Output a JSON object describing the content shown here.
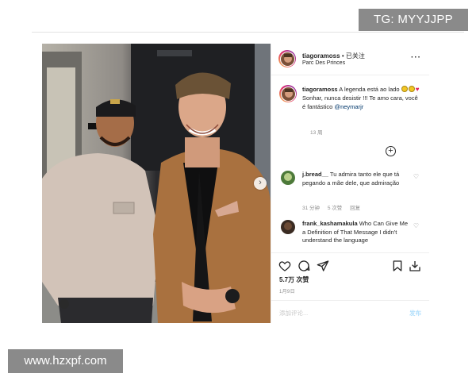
{
  "watermarks": {
    "top": "TG: MYYJJPP",
    "bottom": "www.hzxpf.com"
  },
  "post": {
    "header": {
      "username": "tiagoramoss",
      "follow": "• 已关注",
      "location": "Parc Des Princes"
    },
    "caption": {
      "username": "tiagoramoss",
      "text_start": "A legenda está ao lado",
      "text_end": "Sonhar, nunca desistir !!! Te amo cara, você é fantástico",
      "mention": "@neymarjr",
      "time": "13 周",
      "emojis": [
        "grinning-sweat-emoji",
        "grinning-sweat-emoji",
        "red-heart-emoji"
      ]
    },
    "comments": [
      {
        "username": "j.bread__",
        "text": "Tu admira tanto ele que tá pegando a mãe dele, que admiração",
        "time": "31 分钟",
        "likes": "5 次赞",
        "reply": "回复"
      },
      {
        "username": "frank_kashamakula",
        "text": "Who Can Give Me a Definition of That Message I didn't understand the language"
      }
    ],
    "likes_count": "5.7万 次赞",
    "date": "1月9日",
    "add_comment_placeholder": "添加评论...",
    "post_button": "发布",
    "colors": {
      "link": "#00376b",
      "meta": "#8e8e8e",
      "post_button": "#b2dffc"
    }
  }
}
